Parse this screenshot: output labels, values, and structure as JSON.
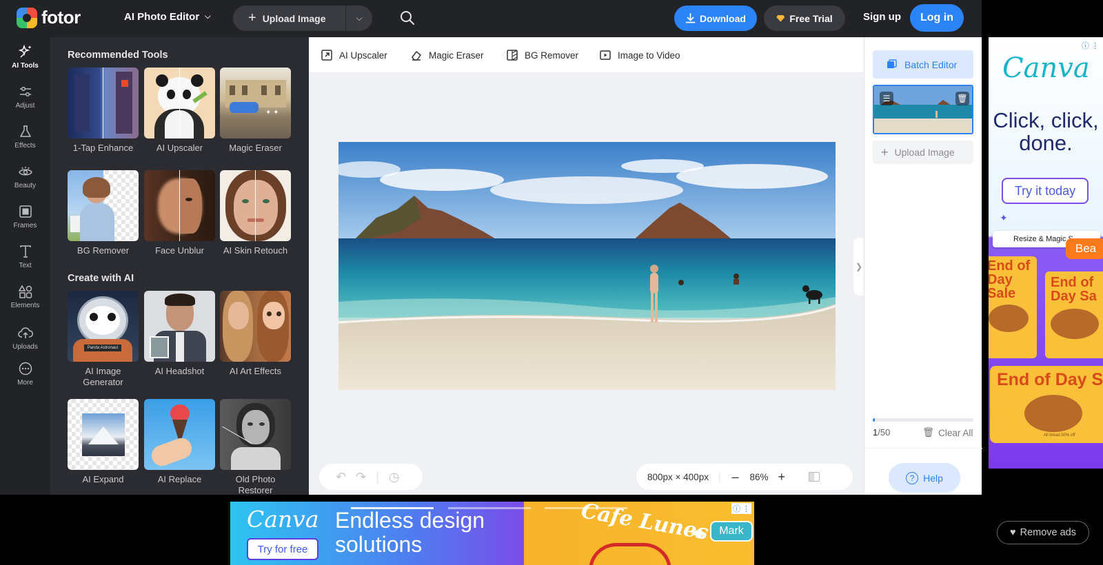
{
  "brand": {
    "logo_text": "fotor"
  },
  "topbar": {
    "editor_menu": "AI Photo Editor",
    "upload_label": "Upload Image",
    "download_label": "Download",
    "trial_label": "Free Trial",
    "signup_label": "Sign up",
    "login_label": "Log in"
  },
  "rail": [
    {
      "label": "AI Tools",
      "icon": "sparkle-icon"
    },
    {
      "label": "Adjust",
      "icon": "sliders-icon"
    },
    {
      "label": "Effects",
      "icon": "flask-icon"
    },
    {
      "label": "Beauty",
      "icon": "eye-icon"
    },
    {
      "label": "Frames",
      "icon": "frame-icon"
    },
    {
      "label": "Text",
      "icon": "text-icon"
    },
    {
      "label": "Elements",
      "icon": "shapes-icon"
    },
    {
      "label": "Uploads",
      "icon": "cloud-upload-icon"
    },
    {
      "label": "More",
      "icon": "more-icon"
    }
  ],
  "panel": {
    "recommended_heading": "Recommended Tools",
    "recommended": [
      "1-Tap Enhance",
      "AI Upscaler",
      "Magic Eraser",
      "BG Remover",
      "Face Unblur",
      "AI Skin Retouch"
    ],
    "create_heading": "Create with AI",
    "create": [
      "AI Image Generator",
      "AI Headshot",
      "AI Art Effects",
      "AI Expand",
      "AI Replace",
      "Old Photo Restorer"
    ],
    "astronaut_badge": "Panda Astronaut"
  },
  "toolbar": [
    "AI Upscaler",
    "Magic Eraser",
    "BG Remover",
    "Image to Video"
  ],
  "canvas": {
    "size_label": "800px × 400px",
    "zoom": "86%"
  },
  "batch": {
    "button": "Batch Editor",
    "upload": "Upload Image",
    "count_current": "1",
    "count_total": "/50",
    "progress": 0.02,
    "clear_all": "Clear All",
    "help": "Help"
  },
  "ads": {
    "right": {
      "brand": "Canva",
      "headline": "Click, click, done.",
      "cta": "Try it today",
      "chip": "Resize & Magic S...",
      "cursor_name": "Bea",
      "sale1": "End of Day Sale",
      "sale2": "End of Day Sa",
      "sale3": "End of Day Sa",
      "small": "All bread 50% off"
    },
    "bottom": {
      "brand": "Canva",
      "headline": "Endless design solutions",
      "cta": "Try for free",
      "cafe": "Cafe Lunes",
      "cursor_name": "Mark"
    },
    "remove_ads": "Remove ads"
  },
  "colors": {
    "accent": "#2b83f6",
    "topbar_bg": "#222327",
    "panel_bg": "#2b2c31"
  }
}
